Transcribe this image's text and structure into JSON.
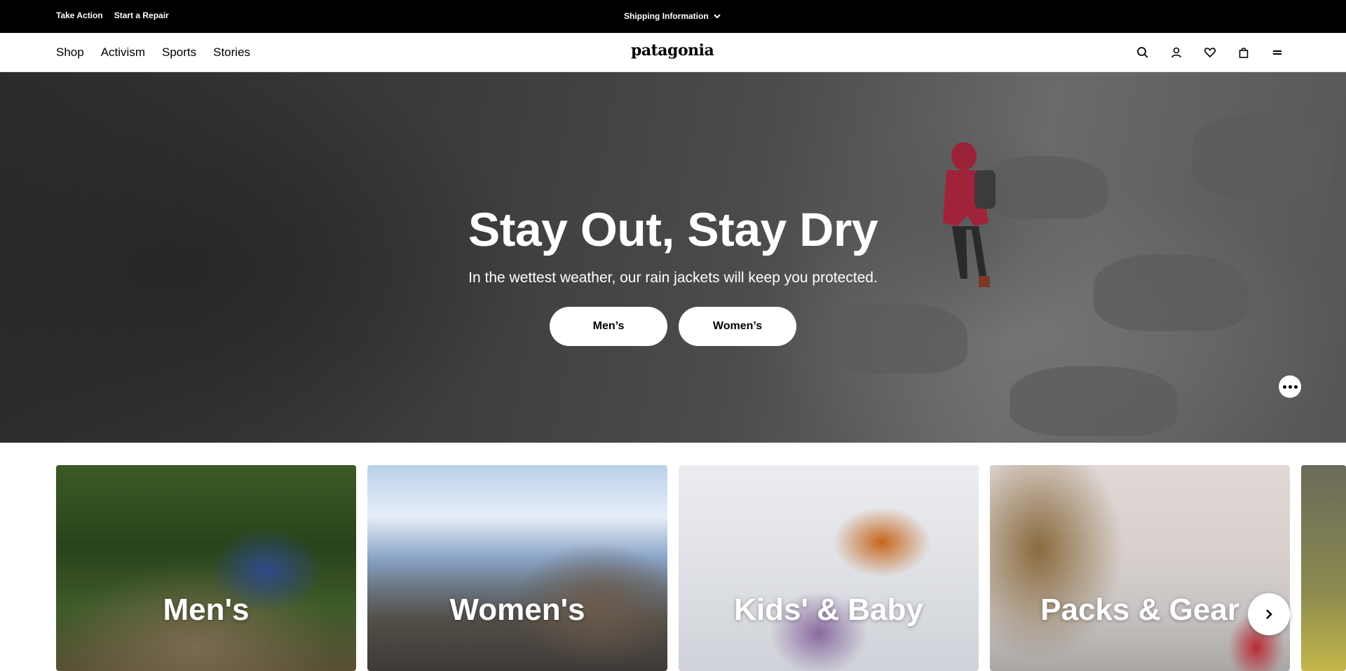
{
  "utility_bar": {
    "links": [
      "Take Action",
      "Start a Repair"
    ],
    "shipping_label": "Shipping Information"
  },
  "nav": {
    "links": [
      "Shop",
      "Activism",
      "Sports",
      "Stories"
    ],
    "logo": "patagonia",
    "icons": [
      "search-icon",
      "account-icon",
      "wishlist-icon",
      "bag-icon",
      "menu-icon"
    ]
  },
  "hero": {
    "title": "Stay Out, Stay Dry",
    "subtitle": "In the wettest weather, our rain jackets will keep you protected.",
    "buttons": [
      "Men’s",
      "Women’s"
    ]
  },
  "categories": [
    {
      "label": "Men's"
    },
    {
      "label": "Women's"
    },
    {
      "label": "Kids' & Baby"
    },
    {
      "label": "Packs & Gear"
    }
  ],
  "colors": {
    "utility_bg": "#000000",
    "button_bg": "#ffffff",
    "text_on_dark": "#ffffff"
  }
}
